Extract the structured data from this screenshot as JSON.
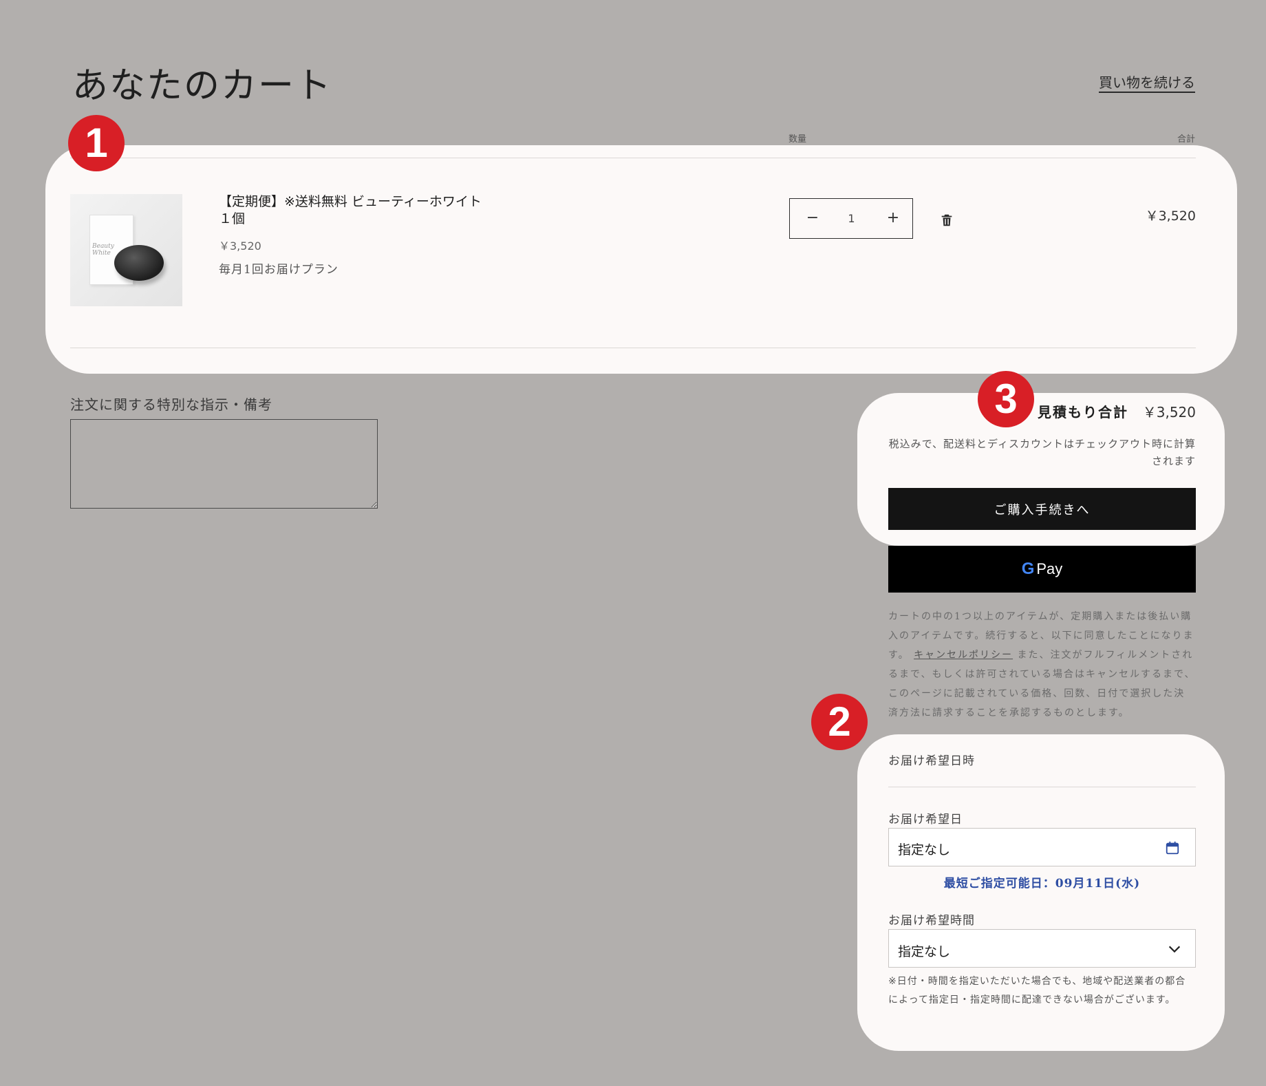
{
  "header": {
    "title": "あなたのカート",
    "continue_label": "買い物を続ける"
  },
  "columns": {
    "quantity": "数量",
    "total": "合計"
  },
  "cart_item": {
    "name": "【定期便】※送料無料 ビューティーホワイト　１個",
    "image_text": "Beauty White",
    "price": "￥3,520",
    "plan": "毎月1回お届けプラン",
    "quantity": "1",
    "line_total": "￥3,520",
    "image_icon": "product-thumbnail",
    "delete_icon": "trash-icon"
  },
  "order_note": {
    "label": "注文に関する特別な指示・備考",
    "value": ""
  },
  "summary": {
    "label": "見積もり合計",
    "value": "￥3,520",
    "tax_note": "税込みで、配送料とディスカウントはチェックアウト時に計算されます",
    "checkout_label": "ご購入手続きへ",
    "gpay_g": "G",
    "gpay_label": "Pay"
  },
  "subscription_terms": {
    "before_link": "カートの中の1つ以上のアイテムが、定期購入または後払い購入のアイテムです。続行すると、以下に同意したことになります。",
    "link": "キャンセルポリシー",
    "after_link": "また、注文がフルフィルメントされるまで、もしくは許可されている場合はキャンセルするまで、このページに記載されている価格、回数、日付で選択した決済方法に請求することを承認するものとします。"
  },
  "delivery": {
    "title": "お届け希望日時",
    "date_label": "お届け希望日",
    "date_value": "指定なし",
    "earliest": "最短ご指定可能日：09月11日(水)",
    "time_label": "お届け希望時間",
    "time_value": "指定なし",
    "note": "※日付・時間を指定いただいた場合でも、地域や配送業者の都合によって指定日・指定時間に配達できない場合がございます。",
    "calendar_icon": "calendar-icon",
    "dropdown_icon": "chevron-down-icon"
  },
  "markers": [
    "1",
    "2",
    "3"
  ],
  "colors": {
    "background": "#b2afad",
    "card": "#fcf9f8",
    "marker": "#d81f26",
    "button": "#141414",
    "earliest_date": "#2e4ea3"
  }
}
